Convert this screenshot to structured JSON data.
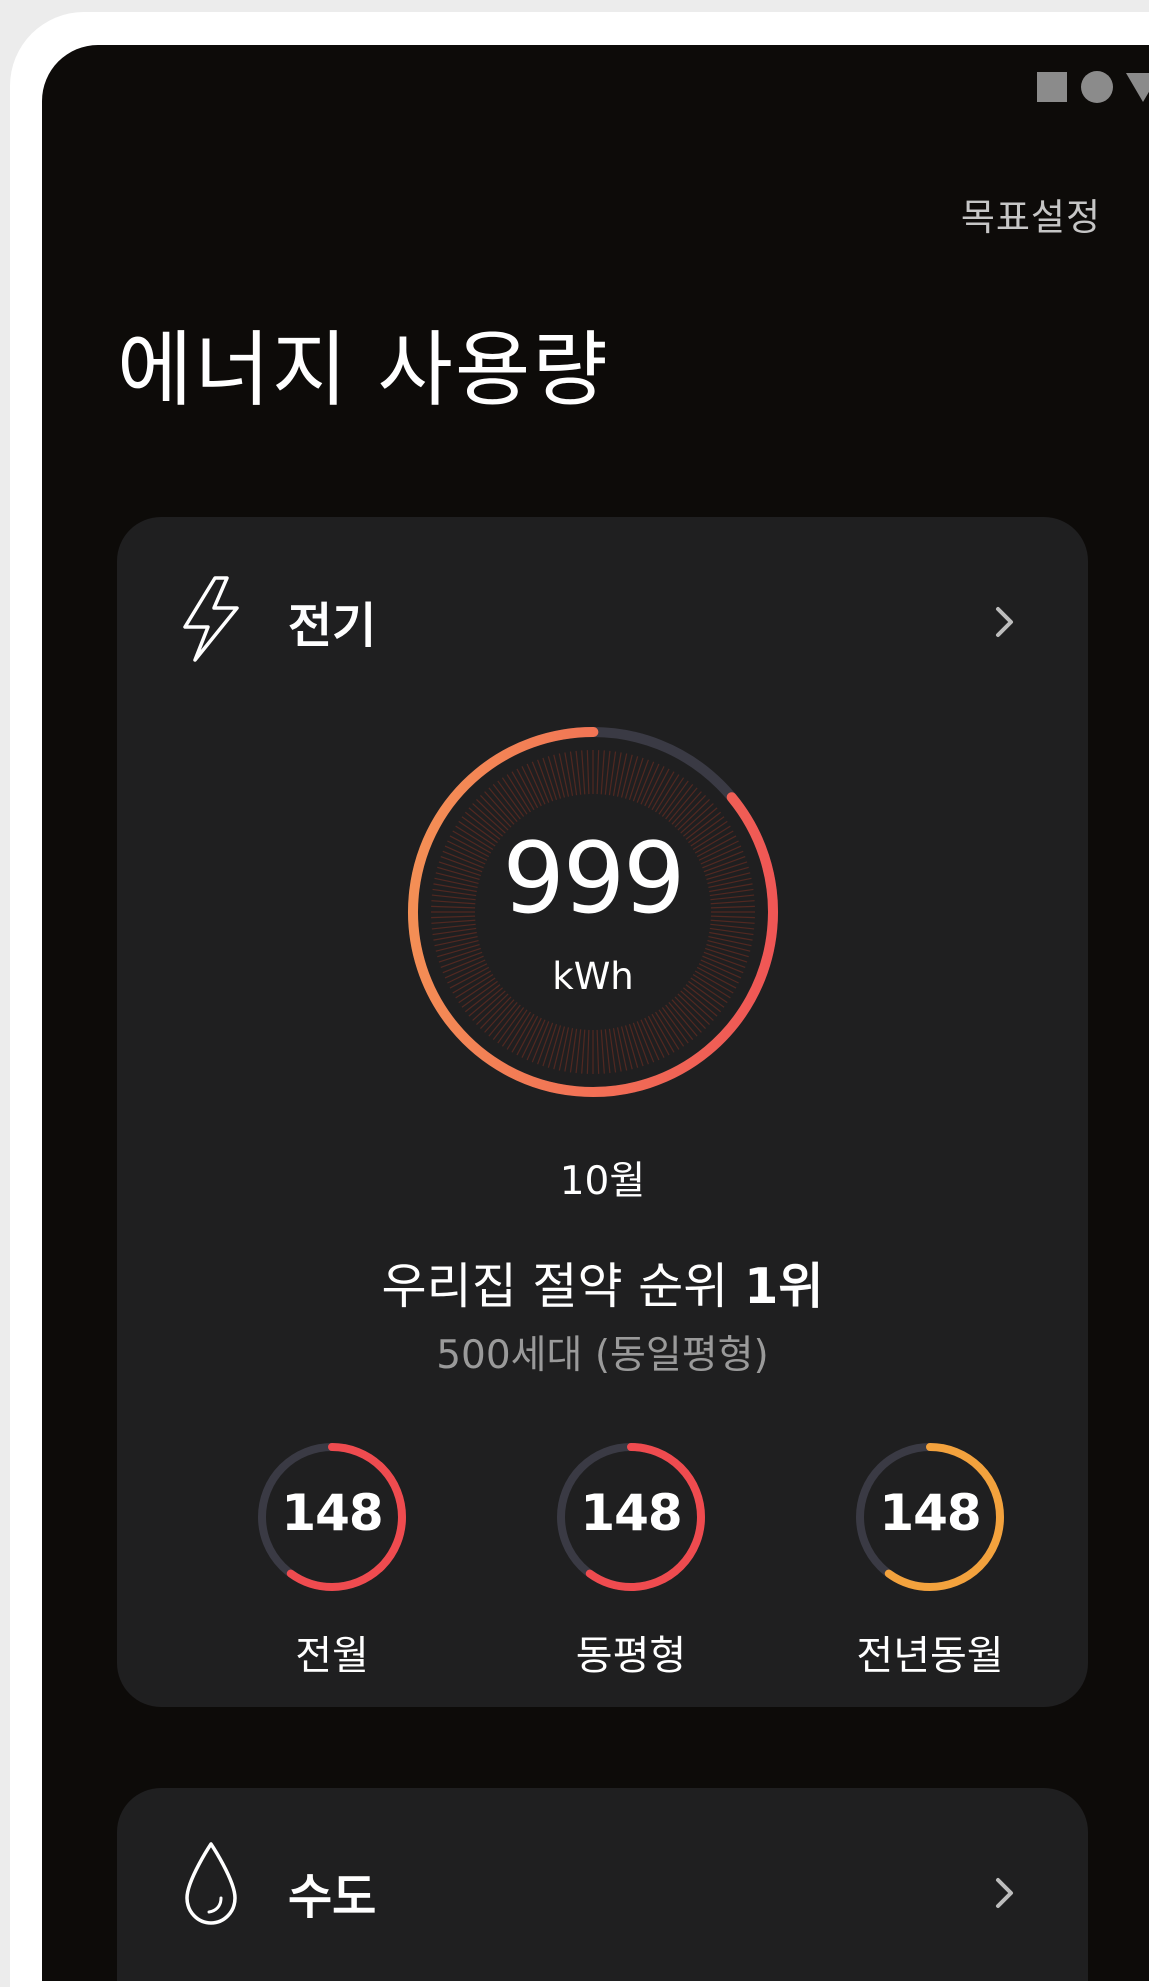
{
  "status_bar": {
    "icons": [
      "square-icon",
      "circle-icon",
      "triangle-icon"
    ]
  },
  "header": {
    "goal_setting_label": "목표설정",
    "title": "에너지 사용량"
  },
  "electricity": {
    "title": "전기",
    "icon": "lightning-icon",
    "usage_value": "999",
    "usage_unit": "kWh",
    "gauge_fill_fraction": 0.86,
    "month": "10월",
    "rank_text": "우리집 절약 순위",
    "rank_value": "1위",
    "household_info": "500세대 (동일평형)",
    "comparisons": [
      {
        "value": "148",
        "label": "전월",
        "fill_fraction": 0.6,
        "color": "#ef4b4f"
      },
      {
        "value": "148",
        "label": "동평형",
        "fill_fraction": 0.6,
        "color": "#ef4b4f"
      },
      {
        "value": "148",
        "label": "전년동월",
        "fill_fraction": 0.6,
        "color": "#f3a23d"
      }
    ]
  },
  "water": {
    "title": "수도",
    "icon": "water-drop-icon"
  },
  "colors": {
    "background": "#0d0b09",
    "card": "#1f1f20",
    "gauge_start": "#f59a55",
    "gauge_end": "#ef4b55",
    "gauge_track": "#3a3a44",
    "secondary_text": "#9a9a9a"
  }
}
